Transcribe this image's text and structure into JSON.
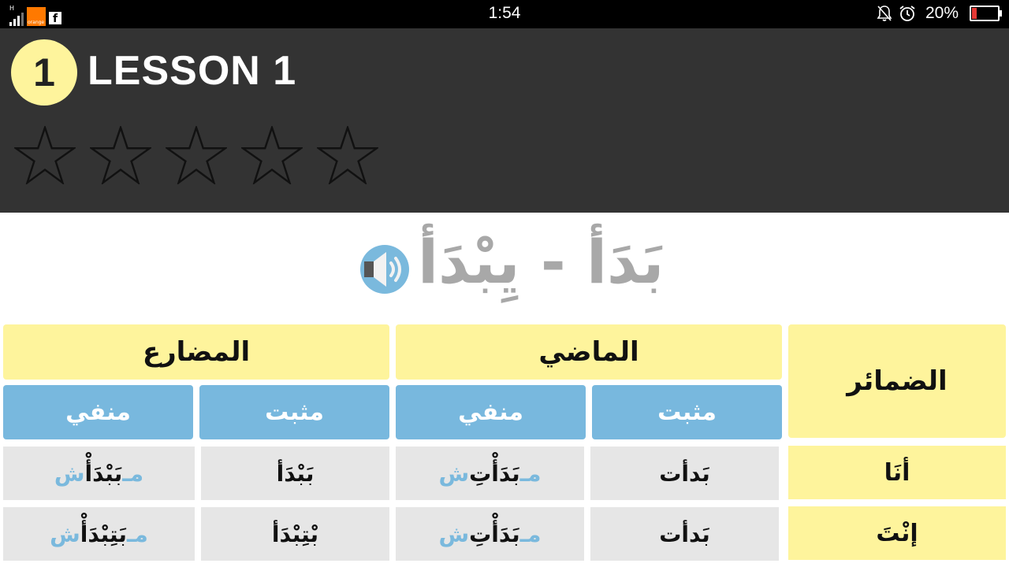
{
  "status_bar": {
    "network_type": "H",
    "carrier_logo_text": "orange",
    "time": "1:54",
    "battery_percent": "20%",
    "battery_level": 0.2,
    "icons": [
      "signal-icon",
      "orange-carrier-icon",
      "facebook-icon",
      "bell-off-icon",
      "alarm-icon",
      "battery-icon"
    ]
  },
  "lesson": {
    "number": "1",
    "title": "LESSON 1",
    "rating": {
      "filled": 0,
      "total": 5
    }
  },
  "verb": {
    "text": "بَدَأ - يِبْدَأ",
    "audio_icon": "speaker-icon"
  },
  "table": {
    "pronouns_header": "الضمائر",
    "groups": [
      {
        "label": "الماضي",
        "affirmative": "مثبت",
        "negative": "منفي"
      },
      {
        "label": "المضارع",
        "affirmative": "مثبت",
        "negative": "منفي"
      }
    ],
    "rows": [
      {
        "pronoun": "أنَا",
        "past_affirmative": "بَدأت",
        "past_negative_prefix": "مـ",
        "past_negative_core": "بَدَأْتِ",
        "past_negative_suffix": "ش",
        "present_affirmative": "بَبْدَأ",
        "present_negative_prefix": "مـ",
        "present_negative_core": "بَبْدَأْ",
        "present_negative_suffix": "ش"
      },
      {
        "pronoun": "إنْتَ",
        "past_affirmative": "بَدأت",
        "past_negative_prefix": "مـ",
        "past_negative_core": "بَدَأْتِ",
        "past_negative_suffix": "ش",
        "present_affirmative": "بْتِبْدَأ",
        "present_negative_prefix": "مـ",
        "present_negative_core": "بَتِبْدَأْ",
        "present_negative_suffix": "ش"
      }
    ]
  },
  "colors": {
    "header_bg": "#333333",
    "yellow": "#fef49c",
    "blue": "#78b8de",
    "cell_gray": "#e6e6e6",
    "verb_gray": "#a8a8a8"
  }
}
